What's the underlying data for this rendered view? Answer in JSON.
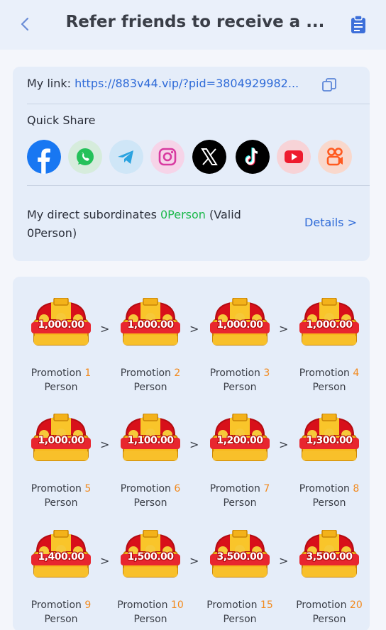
{
  "header": {
    "title": "Refer friends to receive a ..."
  },
  "link": {
    "label": "My link:",
    "url": "https://883v44.vip/?pid=3804929982..."
  },
  "quick_share": {
    "label": "Quick Share",
    "icons": [
      "facebook-icon",
      "whatsapp-icon",
      "telegram-icon",
      "instagram-icon",
      "x-icon",
      "tiktok-icon",
      "youtube-icon",
      "kwai-icon"
    ]
  },
  "subordinates": {
    "prefix": "My direct subordinates ",
    "count": "0Person",
    "suffix": " (Valid 0Person)",
    "details": "Details >"
  },
  "promotions": [
    {
      "amount": "1,000.00",
      "label": "Promotion",
      "num": "1",
      "unit": "Person"
    },
    {
      "amount": "1,000.00",
      "label": "Promotion",
      "num": "2",
      "unit": "Person"
    },
    {
      "amount": "1,000.00",
      "label": "Promotion",
      "num": "3",
      "unit": "Person"
    },
    {
      "amount": "1,000.00",
      "label": "Promotion",
      "num": "4",
      "unit": "Person"
    },
    {
      "amount": "1,000.00",
      "label": "Promotion",
      "num": "5",
      "unit": "Person"
    },
    {
      "amount": "1,100.00",
      "label": "Promotion",
      "num": "6",
      "unit": "Person"
    },
    {
      "amount": "1,200.00",
      "label": "Promotion",
      "num": "7",
      "unit": "Person"
    },
    {
      "amount": "1,300.00",
      "label": "Promotion",
      "num": "8",
      "unit": "Person"
    },
    {
      "amount": "1,400.00",
      "label": "Promotion",
      "num": "9",
      "unit": "Person"
    },
    {
      "amount": "1,500.00",
      "label": "Promotion",
      "num": "10",
      "unit": "Person"
    },
    {
      "amount": "3,500.00",
      "label": "Promotion",
      "num": "15",
      "unit": "Person"
    },
    {
      "amount": "3,500.00",
      "label": "Promotion",
      "num": "20",
      "unit": "Person"
    }
  ],
  "arrow": ">",
  "colors": {
    "accent": "#2f6bd8",
    "green": "#1bb84a",
    "orange": "#f28a1e",
    "card": "#e5edf9"
  }
}
